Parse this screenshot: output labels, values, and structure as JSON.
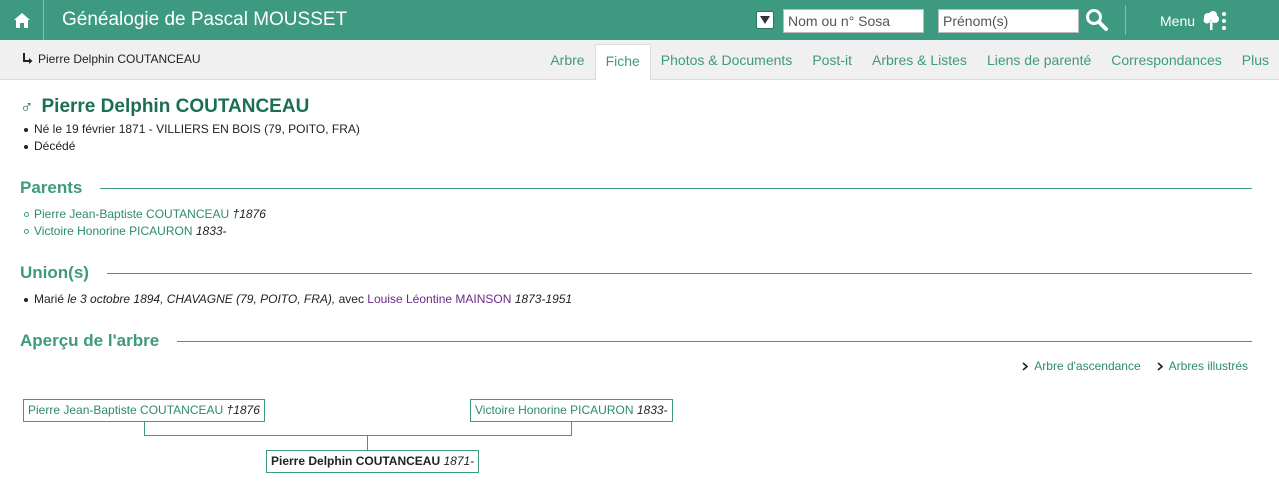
{
  "header": {
    "title": "Généalogie de Pascal MOUSSET",
    "name_placeholder": "Nom ou n° Sosa",
    "firstname_placeholder": "Prénom(s)",
    "menu_label": "Menu"
  },
  "breadcrumb": {
    "label": "Pierre Delphin COUTANCEAU"
  },
  "tabs": [
    {
      "label": "Arbre"
    },
    {
      "label": "Fiche"
    },
    {
      "label": "Photos & Documents"
    },
    {
      "label": "Post-it"
    },
    {
      "label": "Arbres & Listes"
    },
    {
      "label": "Liens de parenté"
    },
    {
      "label": "Correspondances"
    },
    {
      "label": "Plus"
    }
  ],
  "active_tab": "Fiche",
  "person": {
    "symbol": "♂",
    "name": "Pierre Delphin COUTANCEAU",
    "birth": "Né le 19 février 1871 - VILLIERS EN BOIS (79, POITO, FRA)",
    "death": "Décédé"
  },
  "parents": {
    "heading": "Parents",
    "items": [
      {
        "name": "Pierre Jean-Baptiste COUTANCEAU",
        "dates": "†1876"
      },
      {
        "name": "Victoire Honorine PICAURON",
        "dates": "1833-"
      }
    ]
  },
  "unions": {
    "heading": "Union(s)",
    "prefix": "Marié",
    "details": "le 3 octobre 1894, CHAVAGNE (79, POITO, FRA),",
    "with": "avec",
    "spouse": "Louise Léontine MAINSON",
    "spouse_dates": "1873-1951"
  },
  "tree": {
    "heading": "Aperçu de l'arbre",
    "link_ascendance": "Arbre d'ascendance",
    "link_illustres": "Arbres illustrés",
    "father": {
      "name": "Pierre Jean-Baptiste COUTANCEAU",
      "dates": "†1876"
    },
    "mother": {
      "name": "Victoire Honorine PICAURON",
      "dates": "1833-"
    },
    "self": {
      "name": "Pierre Delphin COUTANCEAU",
      "dates": "1871-"
    }
  },
  "colors": {
    "brand": "#3d9a80",
    "link": "#2c8a70",
    "spouse_link": "#6b2a8a"
  }
}
